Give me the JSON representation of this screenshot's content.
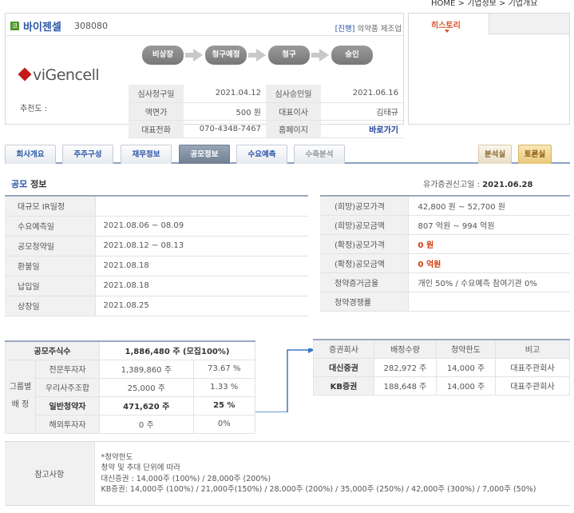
{
  "topnav": "HOME > 기업정보 > 기업개요",
  "company": {
    "badge": "코",
    "name": "바이젠셀",
    "code": "308080",
    "status": "[진행]",
    "category": "의약품 제조업",
    "logo_text": "viGencell",
    "recommend_label": "추천도 :",
    "steps": [
      "비상장",
      "청구예정",
      "청구",
      "승인"
    ],
    "info": [
      {
        "k1": "심사청구일",
        "v1": "2021.04.12",
        "k2": "심사승인일",
        "v2": "2021.06.16"
      },
      {
        "k1": "액면가",
        "v1": "500 원",
        "k2": "대표이사",
        "v2": "김태규"
      },
      {
        "k1": "대표전화",
        "v1": "070-4348-7467",
        "k2": "홈페이지",
        "v2": "바로가기"
      }
    ]
  },
  "history": {
    "tab": "히스토리"
  },
  "tabs": [
    "회사개요",
    "주주구성",
    "재무정보",
    "공모정보",
    "수요예측",
    "수축분석"
  ],
  "right_tabs": [
    "분석실",
    "토론실"
  ],
  "section": {
    "title_a": "공모",
    "title_b": " 정보",
    "report_label": "유가증권신고일 : ",
    "report_date": "2021.06.28"
  },
  "schedule": [
    {
      "k": "대규모 IR일정",
      "v": ""
    },
    {
      "k": "수요예측일",
      "v": "2021.08.06 ~ 08.09"
    },
    {
      "k": "공모청약일",
      "v": "2021.08.12 ~ 08.13"
    },
    {
      "k": "환불일",
      "v": "2021.08.18"
    },
    {
      "k": "납입일",
      "v": "2021.08.18"
    },
    {
      "k": "상장일",
      "v": "2021.08.25"
    }
  ],
  "price": [
    {
      "k": "(희망)공모가격",
      "v": "42,800 원 ~ 52,700 원"
    },
    {
      "k": "(희망)공모금액",
      "v": "807 억원  ~ 994 억원"
    },
    {
      "k": "(확정)공모가격",
      "v": "0 원"
    },
    {
      "k": "(확정)공모금액",
      "v": "0 억원"
    },
    {
      "k": "청약증거금율",
      "v": "개인 50% / 수요예측 참여기관 0%"
    },
    {
      "k": "청약경쟁률",
      "v": ""
    }
  ],
  "shares": {
    "total_label": "공모주식수",
    "total_value": "1,886,480 주 (모집100%)",
    "group_label_1": "그룹별",
    "group_label_2": "배 정",
    "rows": [
      {
        "k": "전문투자자",
        "v": "1,389,860 주",
        "p": "73.67 %"
      },
      {
        "k": "우리사주조합",
        "v": "25,000 주",
        "p": "1.33 %"
      },
      {
        "k": "일반청약자",
        "v": "471,620 주",
        "p": "25 %"
      },
      {
        "k": "해외투자자",
        "v": "0 주",
        "p": "0%"
      }
    ]
  },
  "underwriters": {
    "headers": [
      "증권회사",
      "배정수량",
      "청약한도",
      "비고"
    ],
    "rows": [
      {
        "name": "대신증권",
        "qty": "282,972 주",
        "limit": "14,000 주",
        "note": "대표주관회사"
      },
      {
        "name": "KB증권",
        "qty": "188,648 주",
        "limit": "14,000 주",
        "note": "대표주관회사"
      }
    ]
  },
  "notes": {
    "label": "참고사항",
    "lines": [
      "*청약한도",
      "청약 및 추대 단위에 따라",
      "대신증권 : 14,000주 (100%) / 28,000주 (200%)",
      "KB증권: 14,000주 (100%) / 21,000주(150%) / 28,000주 (200%) / 35,000주 (250%) / 42,000주 (300%) / 7,000주 (50%)"
    ]
  }
}
